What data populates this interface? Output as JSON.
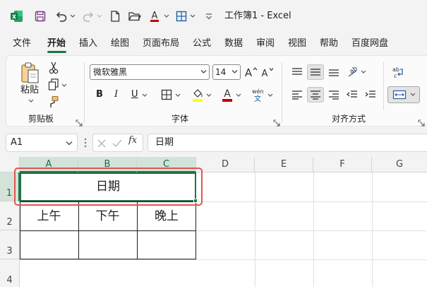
{
  "window": {
    "title": "工作簿1  -  Excel"
  },
  "menu": [
    "文件",
    "开始",
    "插入",
    "绘图",
    "页面布局",
    "公式",
    "数据",
    "审阅",
    "视图",
    "帮助",
    "百度网盘"
  ],
  "ribbon": {
    "clipboard": {
      "paste_label": "粘贴",
      "group_label": "剪贴板"
    },
    "font": {
      "font_name": "微软雅黑",
      "font_size": "14",
      "bold": "B",
      "italic": "I",
      "underline": "U",
      "wen_label": "wén",
      "group_label": "字体"
    },
    "alignment": {
      "group_label": "对齐方式"
    }
  },
  "formula_bar": {
    "name_box": "A1",
    "fx": "fx",
    "formula": "日期"
  },
  "grid": {
    "columns": [
      "A",
      "B",
      "C",
      "D",
      "E",
      "F",
      "G"
    ],
    "rows": [
      "1",
      "2",
      "3",
      "4"
    ],
    "cells": {
      "A1": "日期",
      "A2": "上午",
      "B2": "下午",
      "C2": "晚上"
    }
  },
  "colors": {
    "accent": "#217346",
    "annotation": "#e25555"
  },
  "icons": [
    "excel-logo-icon",
    "save-icon",
    "undo-icon",
    "redo-icon",
    "new-file-icon",
    "open-folder-icon",
    "font-color-icon",
    "borders-icon",
    "customize-icon",
    "paste-icon",
    "cut-icon",
    "copy-icon",
    "format-painter-icon"
  ]
}
